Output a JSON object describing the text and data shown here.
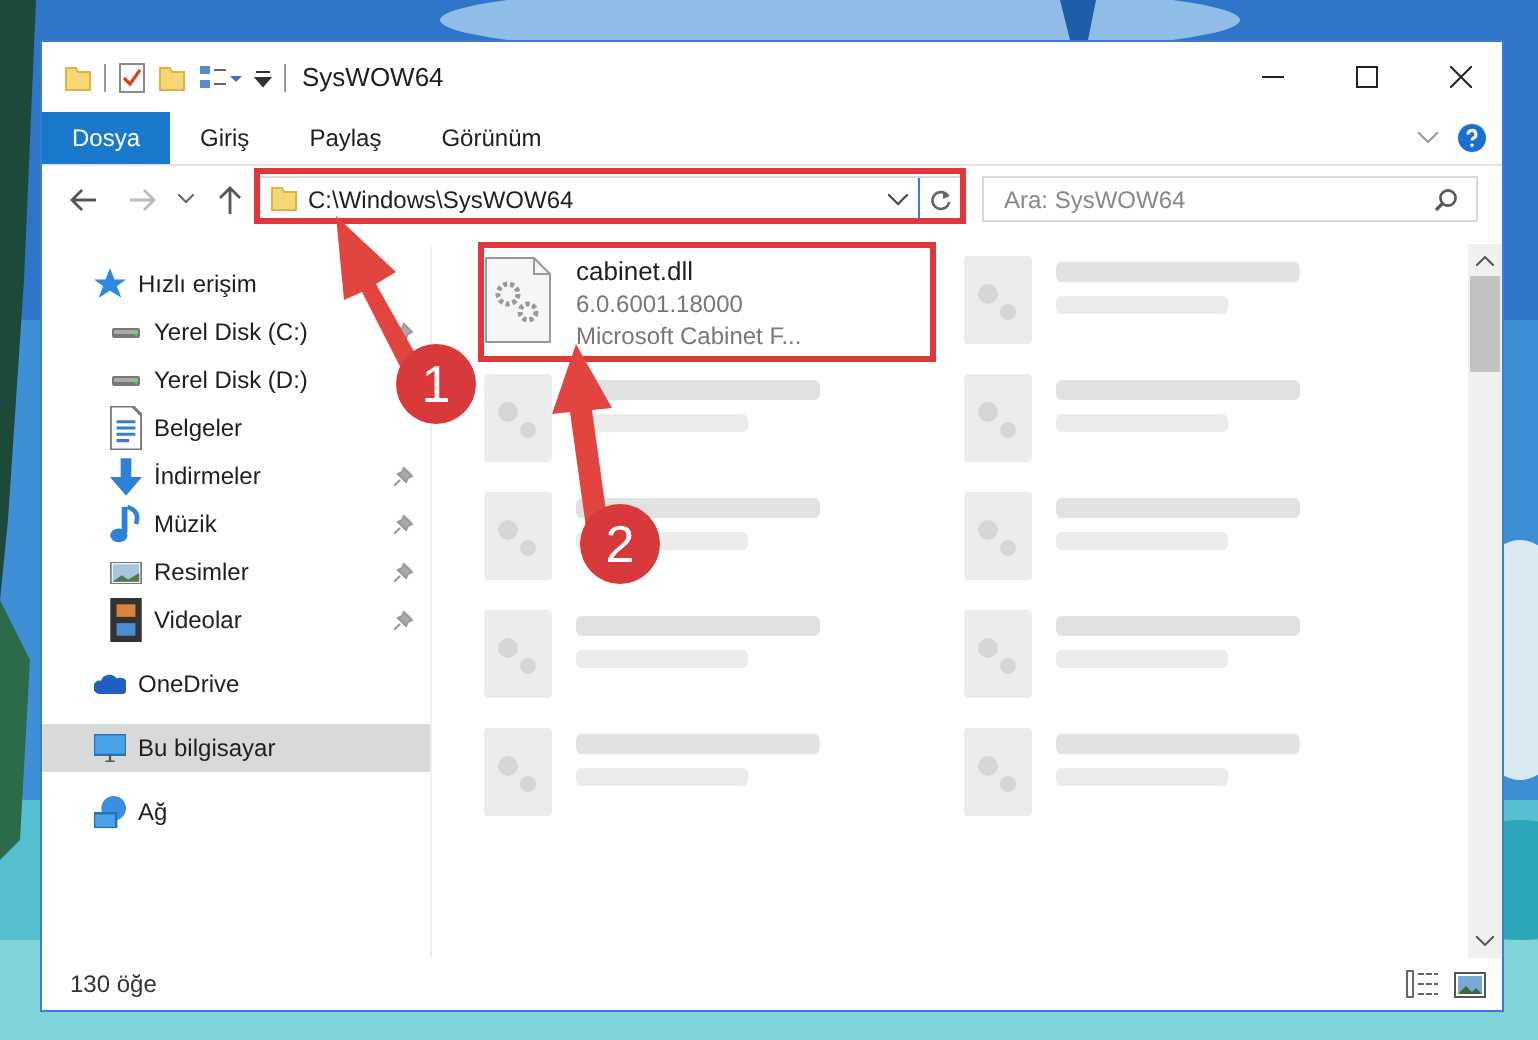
{
  "window": {
    "title": "SysWOW64"
  },
  "ribbon_tabs": [
    {
      "label": "Dosya",
      "selected": true
    },
    {
      "label": "Giriş",
      "selected": false
    },
    {
      "label": "Paylaş",
      "selected": false
    },
    {
      "label": "Görünüm",
      "selected": false
    }
  ],
  "address": {
    "path": "C:\\Windows\\SysWOW64"
  },
  "search": {
    "placeholder": "Ara: SysWOW64"
  },
  "sidebar": {
    "items": [
      {
        "label": "Hızlı erişim",
        "kind": "star",
        "selected": false,
        "children": [
          {
            "label": "Yerel Disk (C:)",
            "kind": "drive",
            "pinned": true,
            "selected": false
          },
          {
            "label": "Yerel Disk (D:)",
            "kind": "drive",
            "pinned": false,
            "selected": false
          },
          {
            "label": "Belgeler",
            "kind": "document",
            "pinned": false,
            "selected": false
          },
          {
            "label": "İndirmeler",
            "kind": "download",
            "pinned": true,
            "selected": false
          },
          {
            "label": "Müzik",
            "kind": "music",
            "pinned": true,
            "selected": false
          },
          {
            "label": "Resimler",
            "kind": "pictures",
            "pinned": true,
            "selected": false
          },
          {
            "label": "Videolar",
            "kind": "video",
            "pinned": true,
            "selected": false
          }
        ]
      },
      {
        "label": "OneDrive",
        "kind": "cloud",
        "selected": false
      },
      {
        "label": "Bu bilgisayar",
        "kind": "computer",
        "selected": true
      },
      {
        "label": "Ağ",
        "kind": "network",
        "selected": false
      }
    ]
  },
  "files": [
    {
      "name": "cabinet.dll",
      "lines": [
        "6.0.6001.18000",
        "Microsoft Cabinet F..."
      ],
      "blurred": false
    },
    {
      "blurred": true
    },
    {
      "blurred": true
    },
    {
      "blurred": true
    },
    {
      "blurred": true
    },
    {
      "blurred": true
    },
    {
      "blurred": true
    },
    {
      "blurred": true
    },
    {
      "blurred": true
    },
    {
      "blurred": true
    }
  ],
  "status_bar": {
    "count": "130 öğe"
  },
  "callouts": [
    {
      "number": "1"
    },
    {
      "number": "2"
    }
  ]
}
